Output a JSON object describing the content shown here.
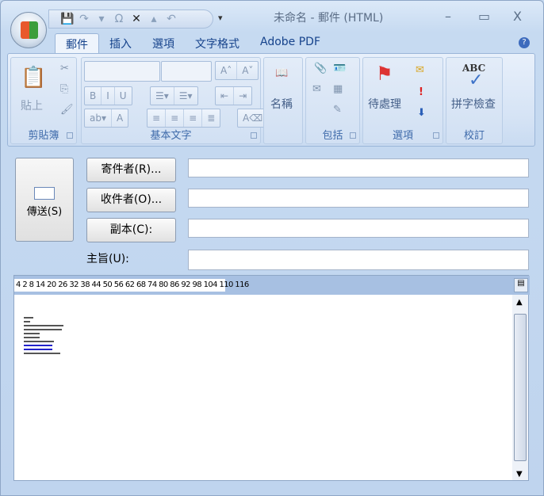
{
  "window": {
    "title": "未命名 - 郵件 (HTML)",
    "minimize": "–",
    "maximize": "▭",
    "close": "X"
  },
  "qat": {
    "save": "💾",
    "redo": "↷",
    "down": "▾",
    "symbol": "Ω",
    "delete": "✕",
    "up": "▴",
    "undo": "↶",
    "customize": "▾"
  },
  "tabs": [
    "郵件",
    "插入",
    "選項",
    "文字格式",
    "Adobe PDF"
  ],
  "help": "?",
  "ribbon": {
    "clipboard": {
      "label": "剪貼簿",
      "paste": "貼上"
    },
    "basic_text": {
      "label": "基本文字",
      "bold": "B",
      "italic": "I",
      "underline": "U",
      "grow": "A˄",
      "shrink": "A˅",
      "font_color": "A"
    },
    "names": {
      "label": "名稱"
    },
    "include": {
      "label": "包括"
    },
    "options": {
      "label": "選項",
      "follow_up": "待處理"
    },
    "proofing": {
      "label": "校訂",
      "spelling": "拼字檢查",
      "abc": "ABC"
    }
  },
  "form": {
    "send": "傳送(S)",
    "from": "寄件者(R)...",
    "to": "收件者(O)...",
    "cc": "副本(C):",
    "subject": "主旨(U):",
    "from_value": "",
    "to_value": "",
    "cc_value": "",
    "subject_value": ""
  },
  "editor": {
    "ruler": "4  2  8  14 20 26 32 38 44 50 56 62 68 74 80 86 92 98 104 110 116"
  }
}
